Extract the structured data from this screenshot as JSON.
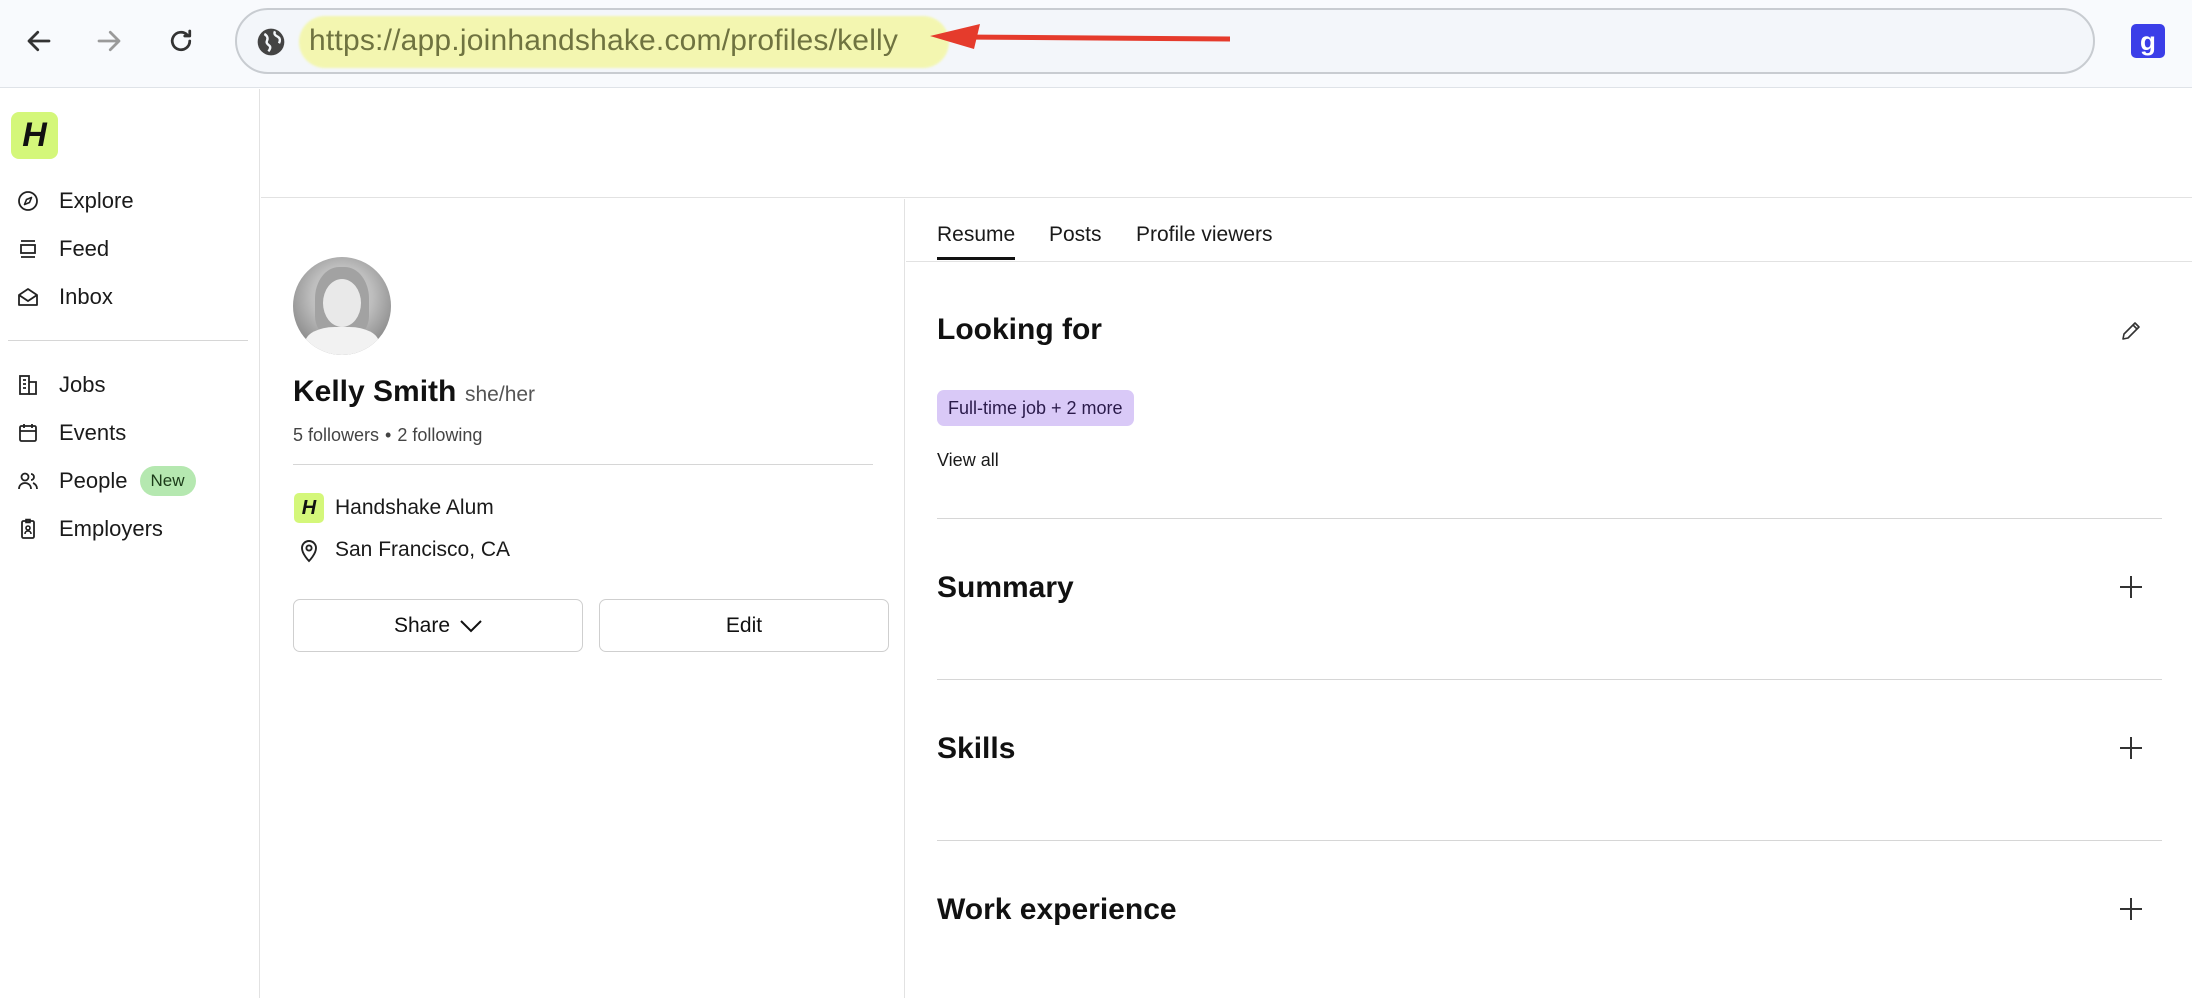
{
  "browser": {
    "url": "https://app.joinhandshake.com/profiles/kelly",
    "extension_label": "g",
    "highlight_color": "#f3f7a8",
    "arrow_color": "#e53b2c"
  },
  "sidebar": {
    "logo": "H",
    "items": [
      {
        "label": "Explore",
        "icon": "compass-icon"
      },
      {
        "label": "Feed",
        "icon": "feed-icon"
      },
      {
        "label": "Inbox",
        "icon": "inbox-icon"
      },
      {
        "label": "Jobs",
        "icon": "building-icon"
      },
      {
        "label": "Events",
        "icon": "calendar-icon"
      },
      {
        "label": "People",
        "icon": "people-icon",
        "badge": "New"
      },
      {
        "label": "Employers",
        "icon": "badge-icon"
      }
    ]
  },
  "profile": {
    "name": "Kelly Smith",
    "pronouns": "she/her",
    "followers": "5 followers",
    "separator": "•",
    "following": "2 following",
    "affiliation_logo": "H",
    "affiliation": "Handshake Alum",
    "location": "San Francisco, CA",
    "share_label": "Share",
    "edit_label": "Edit"
  },
  "tabs": [
    "Resume",
    "Posts",
    "Profile viewers"
  ],
  "resume": {
    "looking_for": {
      "title": "Looking for",
      "chip": "Full-time job + 2 more",
      "view_all": "View all"
    },
    "sections": [
      "Summary",
      "Skills",
      "Work experience"
    ]
  },
  "colors": {
    "brand": "#d4f77a",
    "chip": "#d9c9f7",
    "new_badge": "#b5e8b0"
  }
}
